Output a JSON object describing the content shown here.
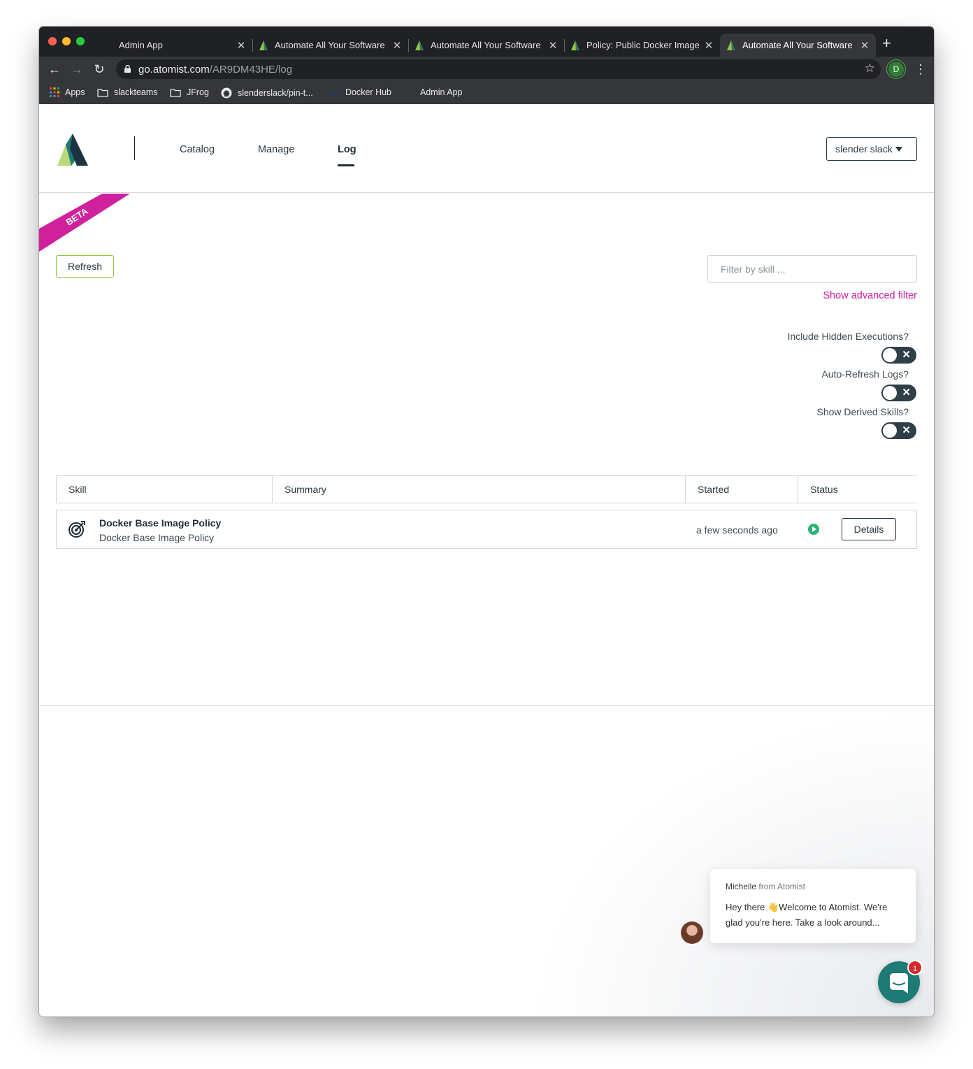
{
  "browser": {
    "tabs": [
      {
        "title": "Admin App"
      },
      {
        "title": "Automate All Your Software"
      },
      {
        "title": "Automate All Your Software"
      },
      {
        "title": "Policy: Public Docker Image"
      },
      {
        "title": "Automate All Your Software"
      }
    ],
    "url_host": "go.atomist.com",
    "url_path": "/AR9DM43HE/log",
    "profile_initial": "D",
    "bookmarks": [
      "Apps",
      "slackteams",
      "JFrog",
      "slenderslack/pin-t...",
      "Docker Hub",
      "Admin App"
    ]
  },
  "nav": {
    "catalog": "Catalog",
    "manage": "Manage",
    "log": "Log",
    "active": "Log",
    "user": "slender slack"
  },
  "beta_label": "BETA",
  "controls": {
    "refresh": "Refresh",
    "filter_placeholder": "Filter by skill ...",
    "advanced_filter": "Show advanced filter",
    "toggles": [
      {
        "label": "Include Hidden Executions?",
        "on": false
      },
      {
        "label": "Auto-Refresh Logs?",
        "on": false
      },
      {
        "label": "Show Derived Skills?",
        "on": false
      }
    ]
  },
  "table": {
    "headers": [
      "Skill",
      "Summary",
      "Started",
      "Status"
    ],
    "rows": [
      {
        "skill_title": "Docker Base Image Policy",
        "skill_subtitle": "Docker Base Image Policy",
        "summary": "",
        "started": "a few seconds ago",
        "status": "running",
        "action": "Details"
      }
    ]
  },
  "chat": {
    "sender": "Michelle",
    "sender_suffix": "from Atomist",
    "message": "Hey there 👋Welcome to Atomist. We're glad you're here.  Take a look around...",
    "unread": "1"
  },
  "colors": {
    "accent_pink": "#d0219c",
    "accent_green": "#8dc63f",
    "status_green": "#2bb673",
    "dark": "#2f3e47",
    "launcher": "#1e7a74"
  }
}
